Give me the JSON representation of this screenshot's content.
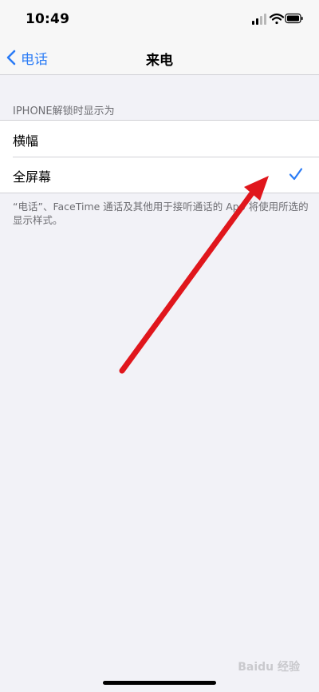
{
  "status_bar": {
    "time": "10:49",
    "icons": [
      "cellular-signal-icon",
      "wifi-icon",
      "battery-icon"
    ]
  },
  "nav": {
    "back_label": "电话",
    "title": "来电"
  },
  "settings": {
    "section_header": "IPHONE解锁时显示为",
    "options": [
      {
        "label": "横幅",
        "selected": false
      },
      {
        "label": "全屏幕",
        "selected": true
      }
    ],
    "footer": "“电话”、FaceTime 通话及其他用于接听通话的 App 将使用所选的显示样式。"
  },
  "watermark": "Baidu 经验",
  "colors": {
    "accent": "#2b7cf6",
    "background": "#f2f2f7",
    "arrow": "#e0161c"
  }
}
